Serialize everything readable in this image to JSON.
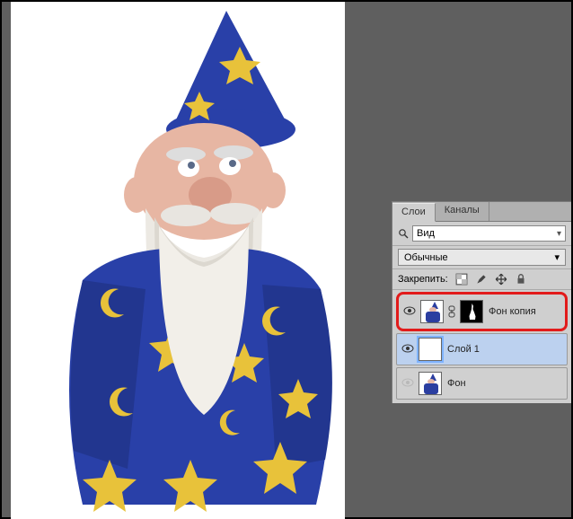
{
  "tabs": {
    "layers": "Слои",
    "channels": "Каналы"
  },
  "search": {
    "label": "Вид",
    "placeholder": "Вид"
  },
  "blend_mode": "Обычные",
  "lock_label": "Закрепить:",
  "layers_list": [
    {
      "name": "Фон копия"
    },
    {
      "name": "Слой 1"
    },
    {
      "name": "Фон"
    }
  ]
}
